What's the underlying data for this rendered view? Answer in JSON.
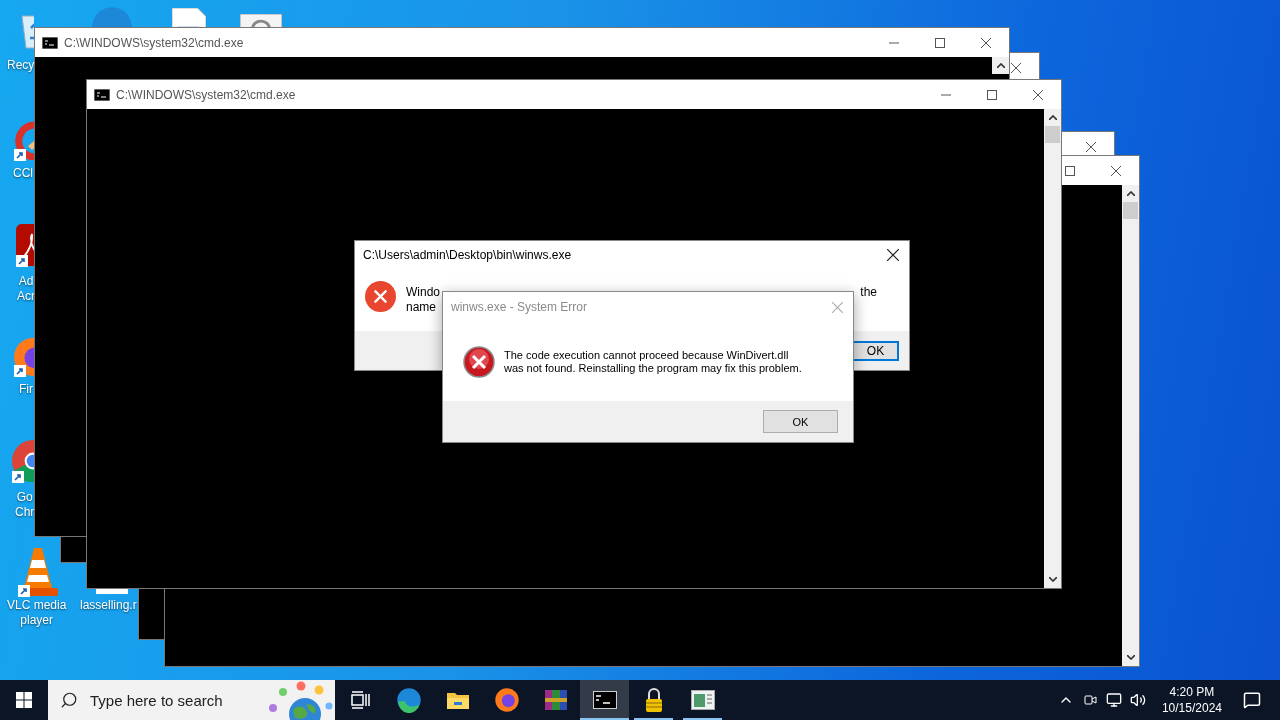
{
  "desktop_icons": [
    {
      "kind": "recycle-bin",
      "shortcut": false,
      "lines": [
        "Recy"
      ]
    },
    {
      "kind": "edge",
      "shortcut": false
    },
    {
      "kind": "document",
      "shortcut": false
    },
    {
      "kind": "settings-page",
      "shortcut": false
    },
    {
      "kind": "ccleaner",
      "shortcut": true,
      "lines": [
        "CCl"
      ]
    },
    {
      "kind": "acrobat",
      "shortcut": true,
      "lines": [
        "Ad",
        "Acr"
      ]
    },
    {
      "kind": "firefox",
      "shortcut": true,
      "lines": [
        "Fir"
      ]
    },
    {
      "kind": "chrome",
      "shortcut": true,
      "lines": [
        "Go",
        "Chr"
      ]
    },
    {
      "kind": "vlc",
      "shortcut": true,
      "lines": [
        "VLC media",
        "player"
      ]
    },
    {
      "kind": "file",
      "shortcut": false,
      "lines": [
        "lasselling.r"
      ]
    }
  ],
  "console_windows": [
    {
      "title": "C:\\WINDOWS\\system32\\cmd.exe"
    },
    {
      "title": "C:\\WINDOWS\\system32\\cmd.exe"
    }
  ],
  "shell_dialog": {
    "title": "C:\\Users\\admin\\Desktop\\bin\\winws.exe",
    "message_parts": [
      "Windo",
      "the",
      "name"
    ],
    "button": "OK",
    "focused": true
  },
  "error_dialog": {
    "title": "winws.exe - System Error",
    "message_lines": [
      "The code execution cannot proceed because WinDivert.dll",
      "was not found. Reinstalling the program may fix this problem."
    ],
    "button": "OK"
  },
  "taskbar": {
    "search": {
      "placeholder": "Type here to search"
    },
    "apps": [
      {
        "kind": "task-view",
        "running": false,
        "active": false
      },
      {
        "kind": "edge",
        "running": false,
        "active": false
      },
      {
        "kind": "explorer",
        "running": false,
        "active": false
      },
      {
        "kind": "firefox",
        "running": false,
        "active": false
      },
      {
        "kind": "winrar",
        "running": false,
        "active": false
      },
      {
        "kind": "console",
        "running": true,
        "active": true
      },
      {
        "kind": "lock",
        "running": true,
        "active": false
      },
      {
        "kind": "app-window",
        "running": true,
        "active": false
      }
    ],
    "tray": {
      "time": "4:20 PM",
      "date": "10/15/2024"
    }
  }
}
